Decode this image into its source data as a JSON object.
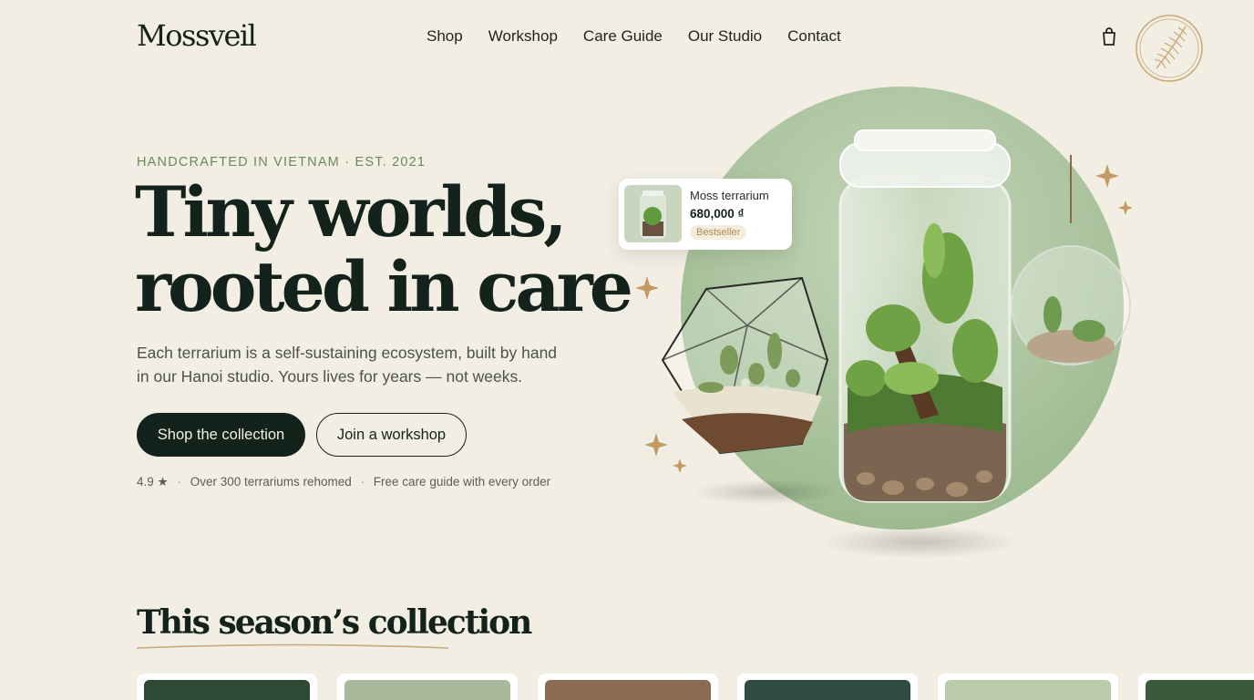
{
  "brand": {
    "name": "Mossveil"
  },
  "nav": {
    "items": [
      {
        "label": "Shop"
      },
      {
        "label": "Workshop"
      },
      {
        "label": "Care Guide"
      },
      {
        "label": "Our Studio"
      },
      {
        "label": "Contact"
      }
    ],
    "cart_icon": "shopping-bag-icon",
    "seal_icon": "fern-leaf-seal-icon"
  },
  "hero": {
    "eyebrow": "HANDCRAFTED IN VIETNAM · EST. 2021",
    "headline_line1": "Tiny worlds,",
    "headline_line2": "rooted in care",
    "description_line1": "Each terrarium is a self-sustaining ecosystem, built by hand",
    "description_line2": "in our Hanoi studio. Yours lives for years — not weeks.",
    "primary_cta": "Shop the collection",
    "secondary_cta": "Join a workshop",
    "rating": "4.9",
    "star_icon": "star-icon",
    "stat_rehomed": "Over 300 terrariums rehomed",
    "stat_guide": "Free care guide with every order"
  },
  "featured_product": {
    "name": "Moss terrarium",
    "price": "680,000 ₫",
    "badge": "Bestseller"
  },
  "collection": {
    "title": "This season’s collection",
    "card_count_visible": 6
  },
  "colors": {
    "background": "#f2eee3",
    "primary": "#13231b",
    "accent_green": "#6b8a5c",
    "accent_gold": "#b08a52",
    "circle_green": "#a9c39d"
  }
}
